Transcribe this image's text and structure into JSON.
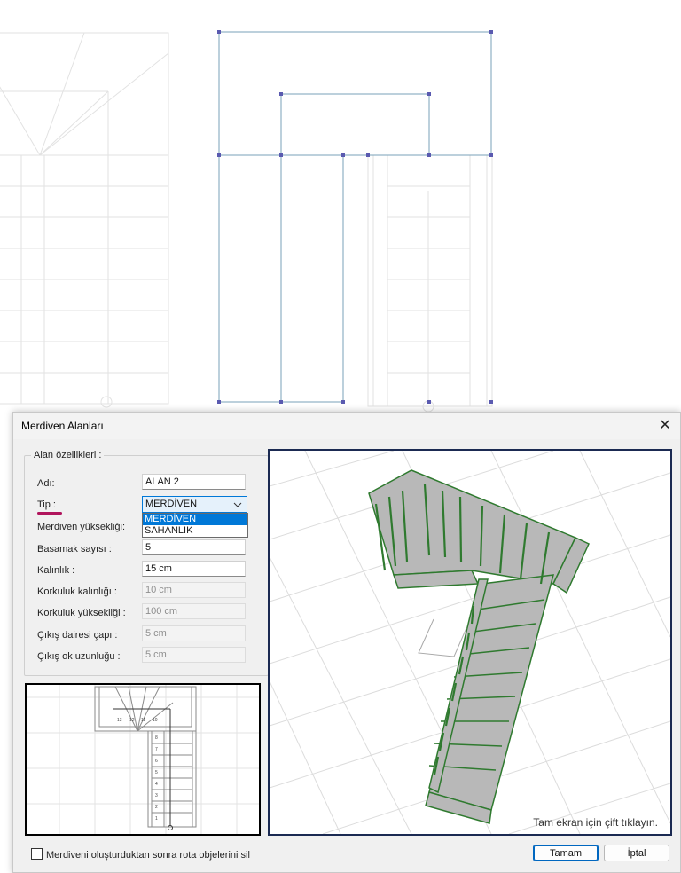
{
  "dialog": {
    "title": "Merdiven Alanları",
    "close_glyph": "✕",
    "group_title": "Alan özellikleri :",
    "fields": {
      "name": {
        "label": "Adı:",
        "value": "ALAN 2"
      },
      "type": {
        "label": "Tip :",
        "value": "MERDİVEN",
        "options": [
          "MERDİVEN",
          "SAHANLIK"
        ],
        "selected_index": 0
      },
      "stair_height": {
        "label": "Merdiven yüksekliği:"
      },
      "step_count": {
        "label": "Basamak sayısı :",
        "value": "5"
      },
      "thickness": {
        "label": "Kalınlık :",
        "value": "15 cm"
      },
      "railing_thickness": {
        "label": "Korkuluk kalınlığı :",
        "value": "10 cm"
      },
      "railing_height": {
        "label": "Korkuluk yüksekliği :",
        "value": "100 cm"
      },
      "exit_circle_diameter": {
        "label": "Çıkış dairesi çapı :",
        "value": "5 cm"
      },
      "exit_arrow_length": {
        "label": "Çıkış ok uzunluğu :",
        "value": "5 cm"
      }
    },
    "preview_hint": "Tam ekran için çift tıklayın.",
    "checkbox_label": "Merdiveni oluşturduktan sonra rota objelerini sil",
    "ok_label": "Tamam",
    "cancel_label": "İptal",
    "plan_step_numbers": [
      "8",
      "7",
      "6",
      "5",
      "4",
      "3",
      "2",
      "1"
    ],
    "plan_winder_numbers": [
      "13",
      "12",
      "11",
      "10"
    ]
  },
  "colors": {
    "accent": "#0078d7",
    "selection_mark": "#b0145c",
    "cad_lines": "#7aa2b8",
    "stair_green": "#2f7a2f"
  }
}
